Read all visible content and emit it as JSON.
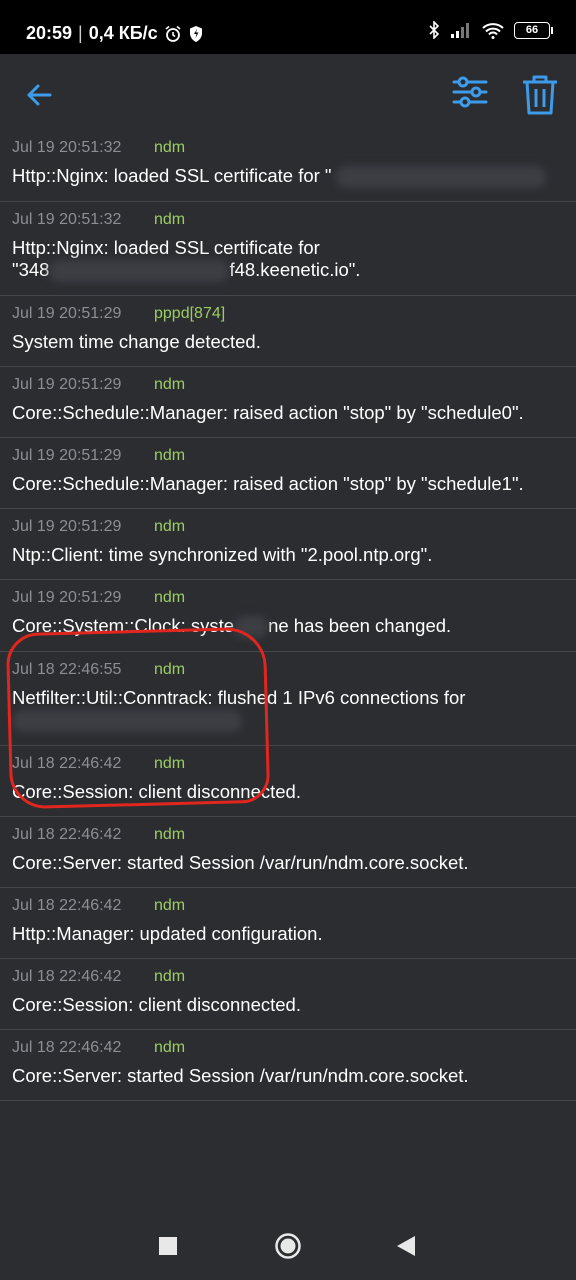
{
  "status_bar": {
    "time": "20:59",
    "separator": "|",
    "net_speed": "0,4 КБ/с",
    "battery": "66"
  },
  "toolbar": {
    "back_icon": "arrow-left-icon",
    "filter_icon": "sliders-icon",
    "delete_icon": "trash-icon",
    "accent": "#3d9be9"
  },
  "colors": {
    "source": "#9ccc65",
    "annotation": "#e0261e"
  },
  "log": [
    {
      "time": "Jul 19 20:51:32",
      "source": "ndm",
      "message": "Http::Nginx: loaded SSL certificate for \""
    },
    {
      "time": "Jul 19 20:51:32",
      "source": "ndm",
      "message": "Http::Nginx: loaded SSL certificate for",
      "message2": "\"348",
      "message3": "f48.keenetic.io\"."
    },
    {
      "time": "Jul 19 20:51:29",
      "source": "pppd[874]",
      "message": "System time change detected."
    },
    {
      "time": "Jul 19 20:51:29",
      "source": "ndm",
      "message": "Core::Schedule::Manager: raised action \"stop\" by \"schedule0\"."
    },
    {
      "time": "Jul 19 20:51:29",
      "source": "ndm",
      "message": "Core::Schedule::Manager: raised action \"stop\" by \"schedule1\"."
    },
    {
      "time": "Jul 19 20:51:29",
      "source": "ndm",
      "message": "Ntp::Client: time synchronized with \"2.pool.ntp.org\"."
    },
    {
      "time": "Jul 19 20:51:29",
      "source": "ndm",
      "message": "Core::System::Clock: syste",
      "message2": "ne has been changed."
    },
    {
      "time": "Jul 18 22:46:55",
      "source": "ndm",
      "message": "Netfilter::Util::Conntrack: flushed 1 IPv6 connections for"
    },
    {
      "time": "Jul 18 22:46:42",
      "source": "ndm",
      "message": "Core::Session: client disconnected."
    },
    {
      "time": "Jul 18 22:46:42",
      "source": "ndm",
      "message": "Core::Server: started Session /var/run/ndm.core.socket."
    },
    {
      "time": "Jul 18 22:46:42",
      "source": "ndm",
      "message": "Http::Manager: updated configuration."
    },
    {
      "time": "Jul 18 22:46:42",
      "source": "ndm",
      "message": "Core::Session: client disconnected."
    },
    {
      "time": "Jul 18 22:46:42",
      "source": "ndm",
      "message": "Core::Server: started Session /var/run/ndm.core.socket."
    }
  ],
  "navbar": {
    "recents_icon": "square-icon",
    "home_icon": "circle-icon",
    "back_icon": "triangle-back-icon"
  }
}
